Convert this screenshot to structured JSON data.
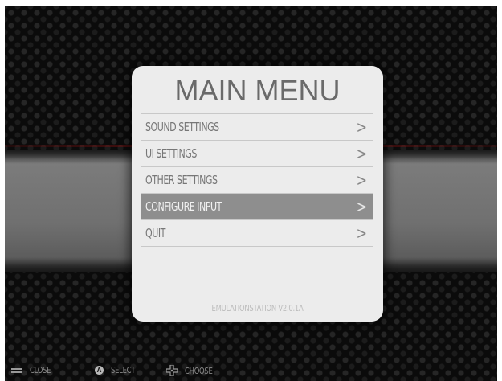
{
  "menu": {
    "title": "MAIN MENU",
    "items": [
      {
        "label": "SOUND SETTINGS",
        "chevron": ">"
      },
      {
        "label": "UI SETTINGS",
        "chevron": ">"
      },
      {
        "label": "OTHER SETTINGS",
        "chevron": ">"
      },
      {
        "label": "CONFIGURE INPUT",
        "chevron": ">",
        "selected": true
      },
      {
        "label": "QUIT",
        "chevron": ">"
      }
    ],
    "version": "EMULATIONSTATION V2.0.1A"
  },
  "help": {
    "close": {
      "icon": "start-button-icon",
      "label": "CLOSE"
    },
    "select": {
      "icon": "a-button-icon",
      "label": "SELECT",
      "glyph": "A"
    },
    "choose": {
      "icon": "dpad-icon",
      "label": "CHOOSE"
    }
  },
  "colors": {
    "panel": "#ececec",
    "selected_row": "#8e8e8e",
    "text": "#777777"
  }
}
